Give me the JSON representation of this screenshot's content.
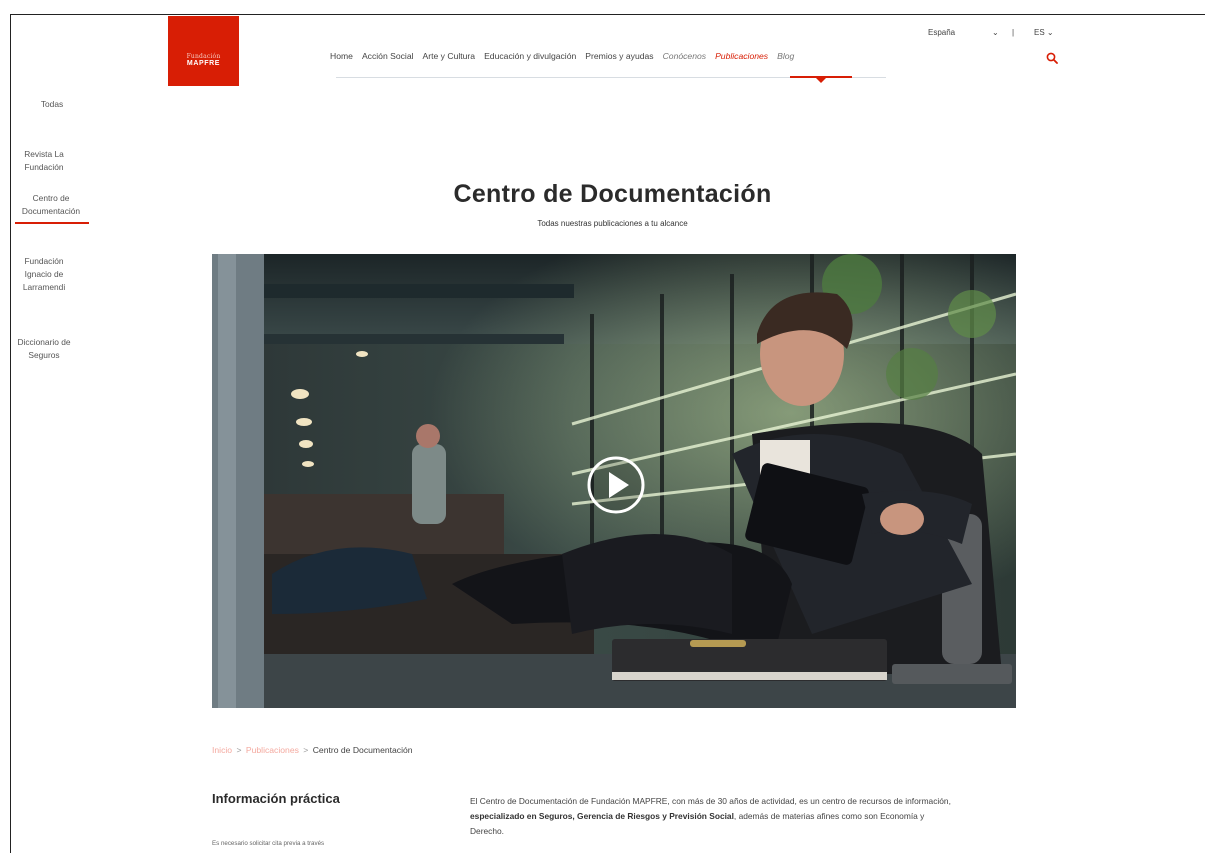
{
  "brand": {
    "logo_line1": "Fundación",
    "logo_line2": "MAPFRE"
  },
  "nav": {
    "items": [
      {
        "label": "Home",
        "style": "normal"
      },
      {
        "label": "Acción Social",
        "style": "normal"
      },
      {
        "label": "Arte y Cultura",
        "style": "normal"
      },
      {
        "label": "Educación y divulgación",
        "style": "normal"
      },
      {
        "label": "Premios y ayudas",
        "style": "normal"
      },
      {
        "label": "Conócenos",
        "style": "italic"
      },
      {
        "label": "Publicaciones",
        "style": "active"
      },
      {
        "label": "Blog",
        "style": "italic"
      }
    ]
  },
  "utility": {
    "country": "España",
    "country_chevron": "⌄",
    "divider": "|",
    "language": "ES ⌄",
    "search_icon": "search-icon"
  },
  "sidebar": {
    "items": [
      {
        "label": "Todas"
      },
      {
        "label": "Revista La Fundación"
      },
      {
        "label": "Centro de Documentación",
        "active": true
      },
      {
        "label": "Fundación Ignacio de Larramendi"
      },
      {
        "label": "Diccionario de Seguros"
      }
    ]
  },
  "hero": {
    "title": "Centro de Documentación",
    "subtitle": "Todas nuestras publicaciones a tu alcance",
    "play_icon": "play-icon"
  },
  "breadcrumb": {
    "items": [
      "Inicio",
      "Publicaciones",
      "Centro de Documentación"
    ],
    "separator": ">"
  },
  "info": {
    "title": "Información práctica",
    "note": "Es necesario solicitar cita previa a través"
  },
  "description": {
    "part1": "El Centro de Documentación de Fundación MAPFRE, con más de 30 años de actividad, es un centro de recursos de información, ",
    "bold": "especializado en Seguros, Gerencia de Riesgos y Previsión Social",
    "part2": ", además de materias afines como son Economía y Derecho."
  },
  "colors": {
    "accent": "#d81e05",
    "link_faded": "#f4a99f",
    "text_dark": "#2b2b2b"
  }
}
